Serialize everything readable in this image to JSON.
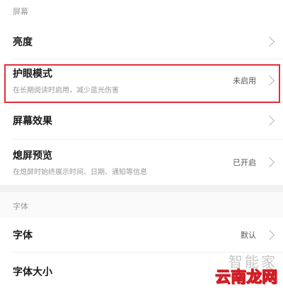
{
  "sections": {
    "screen_header": "屏幕",
    "font_header": "字体"
  },
  "rows": {
    "brightness": {
      "title": "亮度"
    },
    "eye_care": {
      "title": "护眼模式",
      "subtitle": "在长期阅读时启用，减少蓝光伤害",
      "value": "未启用"
    },
    "screen_effect": {
      "title": "屏幕效果"
    },
    "lock_preview": {
      "title": "熄屏预览",
      "subtitle": "在熄屏时始终展示时间、日期、通知等信息",
      "value": "已开启"
    },
    "font": {
      "title": "字体",
      "value": "默认"
    },
    "font_size": {
      "title": "字体大小"
    }
  },
  "watermark": {
    "top": "智能家",
    "main": "云南龙网"
  },
  "colors": {
    "highlight": "#e0303a",
    "watermark_red": "#d01e25"
  }
}
